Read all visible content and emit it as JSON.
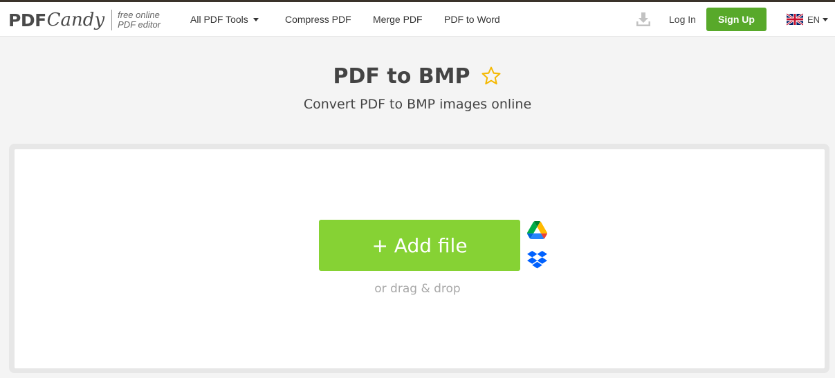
{
  "logo": {
    "pdf": "PDF",
    "candy": "Candy",
    "tagline_line1": "free online",
    "tagline_line2": "PDF editor"
  },
  "nav": {
    "all_tools": "All PDF Tools",
    "compress": "Compress PDF",
    "merge": "Merge PDF",
    "pdf_to_word": "PDF to Word"
  },
  "header": {
    "login": "Log In",
    "signup": "Sign Up",
    "language": "EN"
  },
  "page": {
    "title": "PDF to BMP",
    "subtitle": "Convert PDF to BMP images online"
  },
  "upload": {
    "add_file_label": "+ Add file",
    "drag_hint": "or drag & drop"
  },
  "colors": {
    "accent_green": "#86d234",
    "signup_green": "#58a92a",
    "star_yellow": "#f5b800"
  },
  "icons": {
    "download": "download-icon",
    "star": "star-icon",
    "gdrive": "google-drive-icon",
    "dropbox": "dropbox-icon",
    "flag": "uk-flag-icon"
  }
}
